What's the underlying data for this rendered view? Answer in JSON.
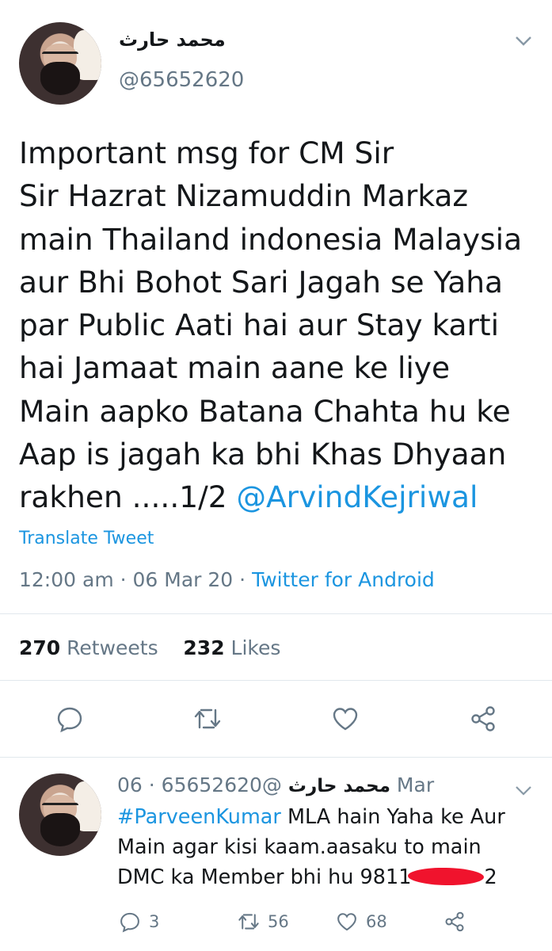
{
  "tweet": {
    "display_name": "محمد حارث",
    "handle": "@65652620",
    "body_lines": [
      "Important msg for CM Sir",
      "Sir Hazrat Nizamuddin Markaz",
      "main Thailand indonesia Malaysia",
      "aur Bhi Bohot Sari Jagah se Yaha",
      "par Public Aati hai aur Stay karti",
      "hai Jamaat main aane ke liye",
      "Main aapko Batana Chahta hu ke",
      "Aap is jagah ka bhi Khas Dhyaan",
      "rakhen .....1/2"
    ],
    "mention": "@ArvindKejriwal",
    "translate_label": "Translate Tweet",
    "time": "12:00 am",
    "date": "06 Mar 20",
    "separator": "·",
    "client": "Twitter for Android",
    "retweets_count": "270",
    "retweets_label": "Retweets",
    "likes_count": "232",
    "likes_label": "Likes"
  },
  "reply": {
    "display_name": "محمد حارث",
    "handle": "@65652620",
    "separator": "·",
    "date": "06 Mar",
    "hashtag": "#ParveenKumar",
    "line1_rest": " MLA hain Yaha ke Aur",
    "line2": "Main agar kisi kaam.aasaku to main",
    "line3": "DMC ka Member bhi hu 9811",
    "line3_end": "2",
    "reply_count": "3",
    "retweet_count": "56",
    "like_count": "68"
  },
  "colors": {
    "link": "#1b95e0",
    "secondary": "#657786",
    "divider": "#e1e8ed",
    "redaction": "#f0132d"
  },
  "icons": [
    "chevron-down-icon",
    "reply-icon",
    "retweet-icon",
    "like-icon",
    "share-icon"
  ]
}
